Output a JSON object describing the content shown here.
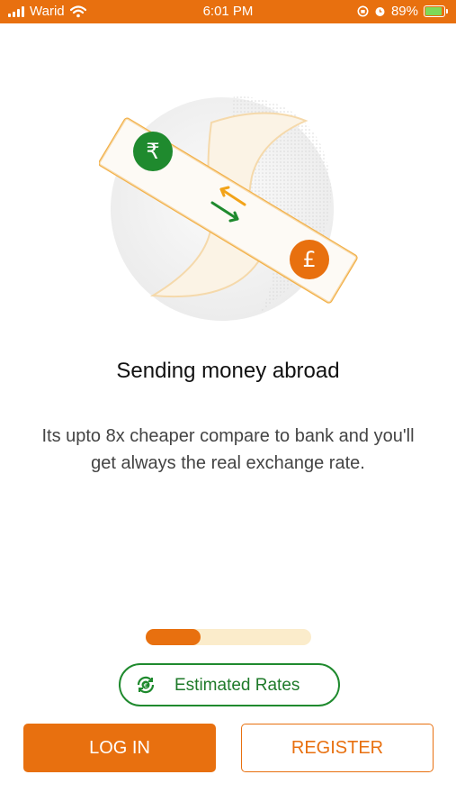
{
  "status_bar": {
    "carrier": "Warid",
    "time": "6:01 PM",
    "battery_percent": "89%",
    "battery_level": 0.89,
    "icons": [
      "signal-icon",
      "wifi-icon",
      "orientation-lock-icon",
      "alarm-icon",
      "battery-charging-icon"
    ]
  },
  "illustration": {
    "icons": [
      "globe-icon",
      "rupee-coin-icon",
      "pound-coin-icon",
      "exchange-arrows-icon"
    ],
    "colors": {
      "green": "#1f8a2e",
      "orange": "#e8700f",
      "globe": "#f4f4f4"
    }
  },
  "onboarding": {
    "title": "Sending money abroad",
    "description": "Its upto 8x cheaper compare to bank and you'll get always the real exchange rate."
  },
  "pager": {
    "current": 1,
    "total": 3,
    "progress": 0.33
  },
  "estimated_rates": {
    "label": "Estimated Rates",
    "icon": "currency-exchange-icon"
  },
  "actions": {
    "login_label": "LOG IN",
    "register_label": "REGISTER"
  },
  "colors": {
    "accent": "#e8700f",
    "green": "#1f8a2e",
    "pager_track": "#fbeccb"
  }
}
